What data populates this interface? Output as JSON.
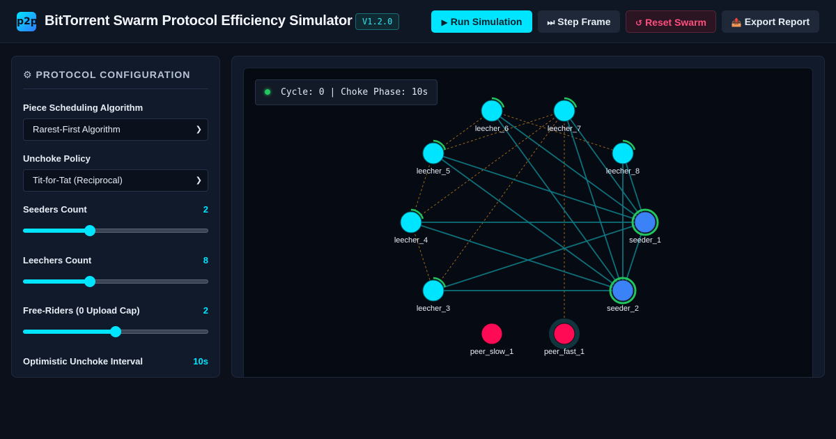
{
  "header": {
    "logo": "p2p",
    "title": "BitTorrent Swarm Protocol Efficiency Simulator",
    "version": "V1.2.0",
    "buttons": {
      "run": {
        "icon": "▶",
        "label": "Run Simulation"
      },
      "step": {
        "icon": "⏭",
        "label": "Step Frame"
      },
      "reset": {
        "icon": "↺",
        "label": "Reset Swarm"
      },
      "export": {
        "icon": "📤",
        "label": "Export Report"
      }
    }
  },
  "config": {
    "title": "⚙ PROTOCOL CONFIGURATION",
    "piece_scheduling": {
      "label": "Piece Scheduling Algorithm",
      "selected": "Rarest-First Algorithm"
    },
    "unchoke_policy": {
      "label": "Unchoke Policy",
      "selected": "Tit-for-Tat (Reciprocal)"
    },
    "seeders": {
      "label": "Seeders Count",
      "value": "2",
      "fraction": 0.35
    },
    "leechers": {
      "label": "Leechers Count",
      "value": "8",
      "fraction": 0.35
    },
    "free_riders": {
      "label": "Free-Riders (0 Upload Cap)",
      "value": "2",
      "fraction": 0.5
    },
    "optimistic_interval": {
      "label": "Optimistic Unchoke Interval",
      "value": "10s"
    }
  },
  "swarm": {
    "status_text": "Cycle: 0 | Choke Phase: 10s",
    "colors": {
      "leecher": "#00e5ff",
      "seeder": "#3b82f6",
      "free_rider": "#ff0a54",
      "progress_ring": "#22c55e",
      "active_link": "#0e7c86",
      "optimistic_link": "#b7791f"
    },
    "nodes": [
      {
        "id": "leecher_6",
        "label": "leecher_6",
        "type": "leecher"
      },
      {
        "id": "leecher_7",
        "label": "leecher_7",
        "type": "leecher"
      },
      {
        "id": "leecher_5",
        "label": "leecher_5",
        "type": "leecher"
      },
      {
        "id": "leecher_8",
        "label": "leecher_8",
        "type": "leecher"
      },
      {
        "id": "leecher_4",
        "label": "leecher_4",
        "type": "leecher"
      },
      {
        "id": "seeder_1",
        "label": "seeder_1",
        "type": "seeder"
      },
      {
        "id": "leecher_3",
        "label": "leecher_3",
        "type": "leecher"
      },
      {
        "id": "seeder_2",
        "label": "seeder_2",
        "type": "seeder"
      },
      {
        "id": "peer_slow_1",
        "label": "peer_slow_1",
        "type": "free_rider"
      },
      {
        "id": "peer_fast_1",
        "label": "peer_fast_1",
        "type": "free_rider"
      }
    ],
    "active_links": [
      [
        "leecher_6",
        "seeder_1"
      ],
      [
        "leecher_6",
        "seeder_2"
      ],
      [
        "leecher_7",
        "seeder_1"
      ],
      [
        "leecher_7",
        "seeder_2"
      ],
      [
        "leecher_5",
        "seeder_1"
      ],
      [
        "leecher_5",
        "seeder_2"
      ],
      [
        "leecher_8",
        "seeder_1"
      ],
      [
        "leecher_8",
        "seeder_2"
      ],
      [
        "leecher_4",
        "seeder_1"
      ],
      [
        "leecher_4",
        "seeder_2"
      ],
      [
        "leecher_3",
        "seeder_1"
      ],
      [
        "leecher_3",
        "seeder_2"
      ],
      [
        "seeder_1",
        "seeder_2"
      ]
    ],
    "optimistic_links": [
      [
        "leecher_6",
        "leecher_8"
      ],
      [
        "leecher_6",
        "leecher_5"
      ],
      [
        "leecher_7",
        "leecher_5"
      ],
      [
        "leecher_7",
        "leecher_4"
      ],
      [
        "leecher_7",
        "leecher_3"
      ],
      [
        "leecher_7",
        "peer_fast_1"
      ],
      [
        "leecher_5",
        "leecher_4"
      ],
      [
        "leecher_4",
        "leecher_3"
      ]
    ]
  }
}
